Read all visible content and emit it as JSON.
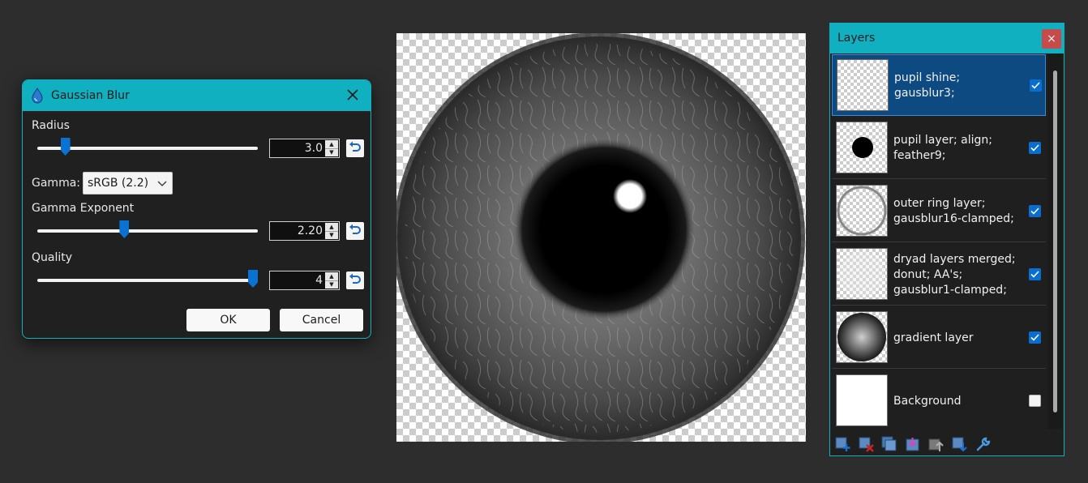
{
  "dialog": {
    "title": "Gaussian Blur",
    "radius": {
      "label": "Radius",
      "value": "3.0",
      "fraction": 0.11
    },
    "gamma": {
      "label": "Gamma:",
      "selected": "sRGB (2.2)"
    },
    "gamma_exponent": {
      "label": "Gamma Exponent",
      "value": "2.20",
      "fraction": 0.39
    },
    "quality": {
      "label": "Quality",
      "value": "4",
      "fraction": 1.0
    },
    "ok_label": "OK",
    "cancel_label": "Cancel"
  },
  "layers": {
    "title": "Layers",
    "close_label": "×",
    "items": [
      {
        "name": "pupil shine; gausblur3;",
        "visible": true,
        "selected": true
      },
      {
        "name": "pupil layer; align; feather9;",
        "visible": true,
        "selected": false
      },
      {
        "name": "outer ring layer; gausblur16-clamped;",
        "visible": true,
        "selected": false
      },
      {
        "name": "dryad layers merged; donut; AA's; gausblur1-clamped;",
        "visible": true,
        "selected": false
      },
      {
        "name": "gradient layer",
        "visible": true,
        "selected": false
      },
      {
        "name": "Background",
        "visible": false,
        "selected": false
      }
    ],
    "toolbar_icons": [
      "add-layer-icon",
      "delete-layer-icon",
      "duplicate-layer-icon",
      "merge-layer-down-icon",
      "move-layer-up-icon",
      "move-layer-down-icon",
      "layer-properties-icon"
    ]
  },
  "colors": {
    "accent": "#10b0c0",
    "slider_thumb": "#0a72d2",
    "selection": "#0e4a82",
    "checkbox": "#0a6ed0",
    "close_red": "#c84b4b"
  }
}
